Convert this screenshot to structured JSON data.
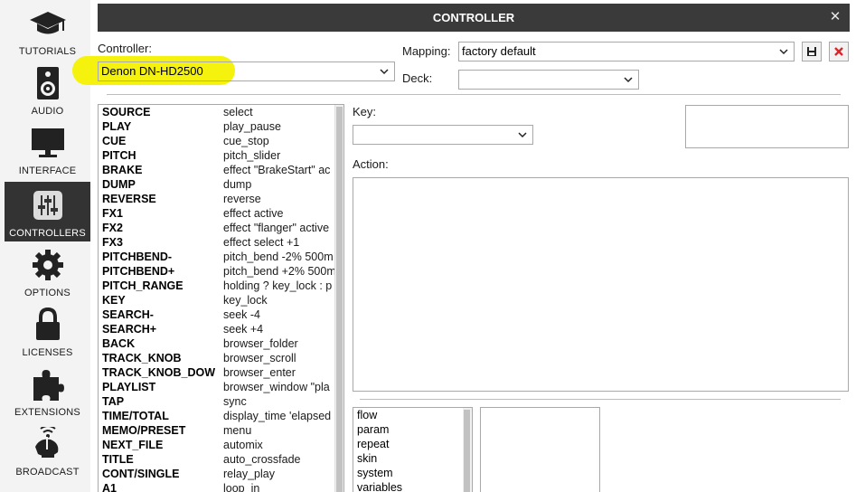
{
  "window": {
    "title": "CONTROLLER"
  },
  "sidebar": {
    "items": [
      {
        "label": "TUTORIALS",
        "icon": "graduation-cap-icon"
      },
      {
        "label": "AUDIO",
        "icon": "speaker-icon"
      },
      {
        "label": "INTERFACE",
        "icon": "monitor-icon"
      },
      {
        "label": "CONTROLLERS",
        "icon": "sliders-icon",
        "active": true
      },
      {
        "label": "OPTIONS",
        "icon": "gear-icon"
      },
      {
        "label": "LICENSES",
        "icon": "lock-icon"
      },
      {
        "label": "EXTENSIONS",
        "icon": "puzzle-icon"
      },
      {
        "label": "BROADCAST",
        "icon": "satellite-dish-icon"
      }
    ]
  },
  "form": {
    "controller_label": "Controller:",
    "controller_value": "Denon DN-HD2500",
    "mapping_label": "Mapping:",
    "mapping_value": "factory default",
    "deck_label": "Deck:",
    "deck_value": "",
    "key_label": "Key:",
    "key_value": "",
    "action_label": "Action:",
    "action_value": ""
  },
  "mappings": [
    {
      "key": "SOURCE",
      "action": "select"
    },
    {
      "key": "PLAY",
      "action": "play_pause"
    },
    {
      "key": "CUE",
      "action": "cue_stop"
    },
    {
      "key": "PITCH",
      "action": "pitch_slider"
    },
    {
      "key": "BRAKE",
      "action": "effect \"BrakeStart\" ac"
    },
    {
      "key": "DUMP",
      "action": "dump"
    },
    {
      "key": "REVERSE",
      "action": "reverse"
    },
    {
      "key": "FX1",
      "action": "effect active"
    },
    {
      "key": "FX2",
      "action": "effect \"flanger\" active"
    },
    {
      "key": "FX3",
      "action": "effect select +1"
    },
    {
      "key": "PITCHBEND-",
      "action": "pitch_bend -2% 500m"
    },
    {
      "key": "PITCHBEND+",
      "action": "pitch_bend +2% 500m"
    },
    {
      "key": "PITCH_RANGE",
      "action": "holding ? key_lock : p"
    },
    {
      "key": "KEY",
      "action": "key_lock"
    },
    {
      "key": "SEARCH-",
      "action": "seek -4"
    },
    {
      "key": "SEARCH+",
      "action": "seek +4"
    },
    {
      "key": "BACK",
      "action": "browser_folder"
    },
    {
      "key": "TRACK_KNOB",
      "action": "browser_scroll"
    },
    {
      "key": "TRACK_KNOB_DOW",
      "action": "browser_enter"
    },
    {
      "key": "PLAYLIST",
      "action": "browser_window \"pla"
    },
    {
      "key": "TAP",
      "action": "sync"
    },
    {
      "key": "TIME/TOTAL",
      "action": "display_time 'elapsed"
    },
    {
      "key": "MEMO/PRESET",
      "action": "menu"
    },
    {
      "key": "NEXT_FILE",
      "action": "automix"
    },
    {
      "key": "TITLE",
      "action": "auto_crossfade"
    },
    {
      "key": "CONT/SINGLE",
      "action": "relay_play"
    },
    {
      "key": "A1",
      "action": "loop_in"
    }
  ],
  "categories": [
    "flow",
    "param",
    "repeat",
    "skin",
    "system",
    "variables"
  ],
  "colors": {
    "titlebar": "#3a3a3a",
    "sidebar_active": "#333333",
    "highlight": "#f4f100",
    "delete": "#d9262b"
  }
}
